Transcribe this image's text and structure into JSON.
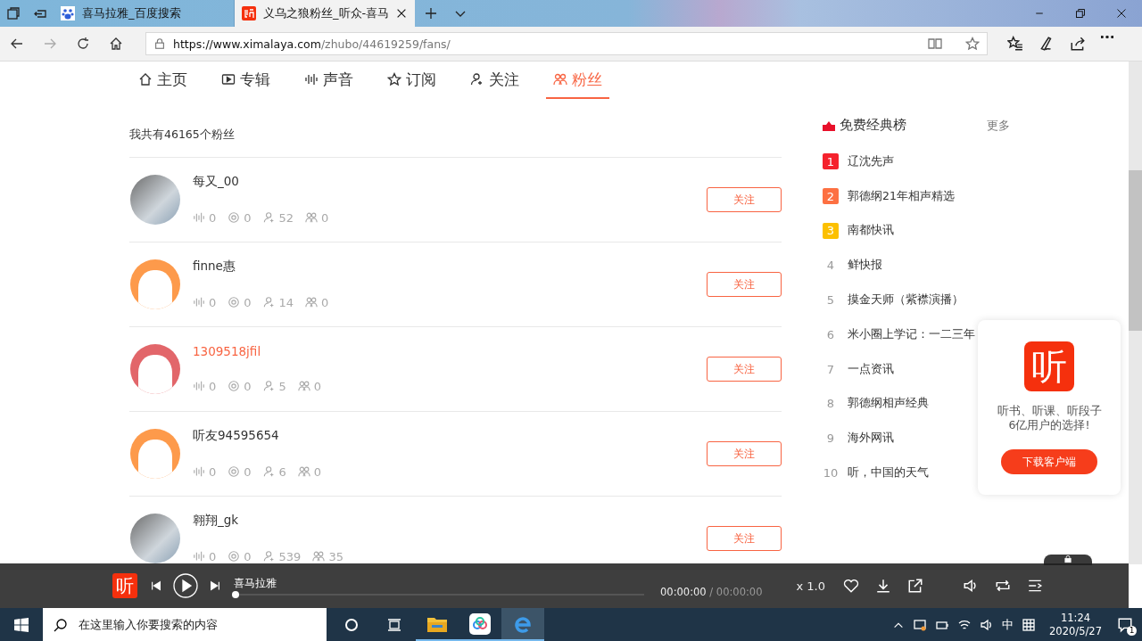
{
  "browser": {
    "tabs": [
      {
        "title": "喜马拉雅_百度搜索",
        "selected": false
      },
      {
        "title": "义乌之狼粉丝_听众-喜马",
        "selected": true
      }
    ],
    "url_host": "https://www.ximalaya.com",
    "url_path": "/zhubo/44619259/fans/"
  },
  "nav": [
    {
      "label": "主页",
      "selected": false
    },
    {
      "label": "专辑",
      "selected": false
    },
    {
      "label": "声音",
      "selected": false
    },
    {
      "label": "订阅",
      "selected": false
    },
    {
      "label": "关注",
      "selected": false
    },
    {
      "label": "粉丝",
      "selected": true
    }
  ],
  "fans_count": "我共有46165个粉丝",
  "fans": [
    {
      "name": "每又_00",
      "kind": "photo",
      "hovered": false,
      "stats": [
        "0",
        "0",
        "52",
        "0"
      ],
      "button": "关注"
    },
    {
      "name": "finne惠",
      "kind": "cat",
      "color": "#fd9a4b",
      "hovered": false,
      "stats": [
        "0",
        "0",
        "14",
        "0"
      ],
      "button": "关注"
    },
    {
      "name": "1309518jfil",
      "kind": "cat",
      "color": "#e2666a",
      "hovered": true,
      "stats": [
        "0",
        "0",
        "5",
        "0"
      ],
      "button": "关注"
    },
    {
      "name": "听友94595654",
      "kind": "cat",
      "color": "#fd9a4b",
      "hovered": false,
      "stats": [
        "0",
        "0",
        "6",
        "0"
      ],
      "button": "关注"
    },
    {
      "name": "翱翔_gk",
      "kind": "photo",
      "hovered": false,
      "stats": [
        "0",
        "0",
        "539",
        "35"
      ],
      "button": "关注"
    }
  ],
  "ranking": {
    "title": "免费经典榜",
    "more": "更多",
    "items": [
      {
        "rank": "1",
        "title": "辽沈先声",
        "color": "#f5222d"
      },
      {
        "rank": "2",
        "title": "郭德纲21年相声精选",
        "color": "#fd7042"
      },
      {
        "rank": "3",
        "title": "南都快讯",
        "color": "#fcc000"
      },
      {
        "rank": "4",
        "title": "鲜快报"
      },
      {
        "rank": "5",
        "title": "摸金天师（紫襟演播）"
      },
      {
        "rank": "6",
        "title": "米小圈上学记：一二三年"
      },
      {
        "rank": "7",
        "title": "一点资讯"
      },
      {
        "rank": "8",
        "title": "郭德纲相声经典"
      },
      {
        "rank": "9",
        "title": "海外网讯"
      },
      {
        "rank": "10",
        "title": "听，中国的天气"
      }
    ]
  },
  "promo": {
    "logo_text": "听",
    "line1": "听书、听课、听段子",
    "line2": "6亿用户的选择!",
    "button": "下载客户端"
  },
  "player": {
    "logo_text": "听",
    "title": "喜马拉雅",
    "level": 0,
    "time": "00:00:00",
    "duration": "/ 00:00:00",
    "speed": "x 1.0"
  },
  "taskbar": {
    "search_placeholder": "在这里输入你要搜索的内容",
    "ime": "中",
    "time": "11:24",
    "date": "2020/5/27",
    "notifications": "1"
  }
}
